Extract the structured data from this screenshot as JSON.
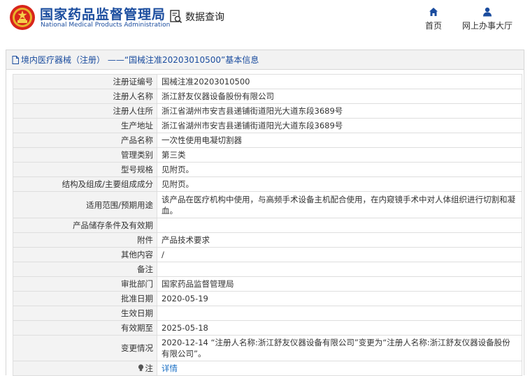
{
  "header": {
    "site_name_cn": "国家药品监督管理局",
    "site_name_en": "National Medical Products Administration",
    "search_label": "数据查询",
    "nav": [
      {
        "label": "首页",
        "icon": "home-icon"
      },
      {
        "label": "网上办事大厅",
        "icon": "user-icon"
      }
    ]
  },
  "panel": {
    "title": "境内医疗器械（注册） ——“国械注准20203010500”基本信息"
  },
  "rows": [
    {
      "label": "注册证编号",
      "value": "国械注准20203010500"
    },
    {
      "label": "注册人名称",
      "value": "浙江舒友仪器设备股份有限公司"
    },
    {
      "label": "注册人住所",
      "value": "浙江省湖州市安吉县递铺街道阳光大道东段3689号"
    },
    {
      "label": "生产地址",
      "value": "浙江省湖州市安吉县递铺街道阳光大道东段3689号"
    },
    {
      "label": "产品名称",
      "value": "一次性使用电凝切割器"
    },
    {
      "label": "管理类别",
      "value": "第三类"
    },
    {
      "label": "型号规格",
      "value": "见附页。"
    },
    {
      "label": "结构及组成/主要组成成分",
      "value": "见附页。"
    },
    {
      "label": "适用范围/预期用途",
      "value": "该产品在医疗机构中使用，与高频手术设备主机配合使用，在内窥镜手术中对人体组织进行切割和凝血。"
    },
    {
      "label": "产品储存条件及有效期",
      "value": ""
    },
    {
      "label": "附件",
      "value": "产品技术要求"
    },
    {
      "label": "其他内容",
      "value": "/"
    },
    {
      "label": "备注",
      "value": ""
    },
    {
      "label": "审批部门",
      "value": "国家药品监督管理局"
    },
    {
      "label": "批准日期",
      "value": "2020-05-19"
    },
    {
      "label": "生效日期",
      "value": ""
    },
    {
      "label": "有效期至",
      "value": "2025-05-18"
    },
    {
      "label": "变更情况",
      "value": "2020-12-14 “注册人名称:浙江舒友仪器设备有限公司”变更为“注册人名称:浙江舒友仪器设备股份有限公司”。"
    }
  ],
  "note": {
    "label": "注",
    "link_text": "详情"
  },
  "colors": {
    "brand_blue": "#1a4c9e",
    "label_bg": "#f3f3f3",
    "link": "#1a6fc4"
  }
}
